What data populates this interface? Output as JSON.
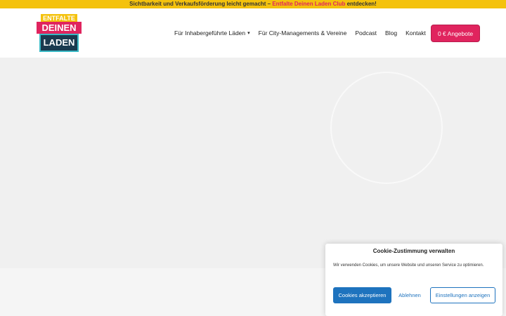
{
  "topbar": {
    "prefix": "Sichtbarkeit und Verkaufsförderung leicht gemacht – ",
    "link": "Entfalte Deinen Laden Club",
    "suffix": " entdecken!"
  },
  "logo": {
    "line1": "ENTFALTE",
    "line2": "DEINEN",
    "line3": "LADEN"
  },
  "nav": {
    "items": [
      {
        "label": "Für Inhabergeführte Läden",
        "caret": "▾"
      },
      {
        "label": "Für City-Managements & Vereine"
      },
      {
        "label": "Podcast"
      },
      {
        "label": "Blog"
      },
      {
        "label": "Kontakt"
      }
    ],
    "cta": "0 € Angebote"
  },
  "cookie": {
    "title": "Cookie-Zustimmung verwalten",
    "text": "Wir verwenden Cookies, um unsere Website und unseren Service zu optimieren.",
    "accept": "Cookies akzeptieren",
    "deny": "Ablehnen",
    "settings": "Einstellungen anzeigen"
  }
}
